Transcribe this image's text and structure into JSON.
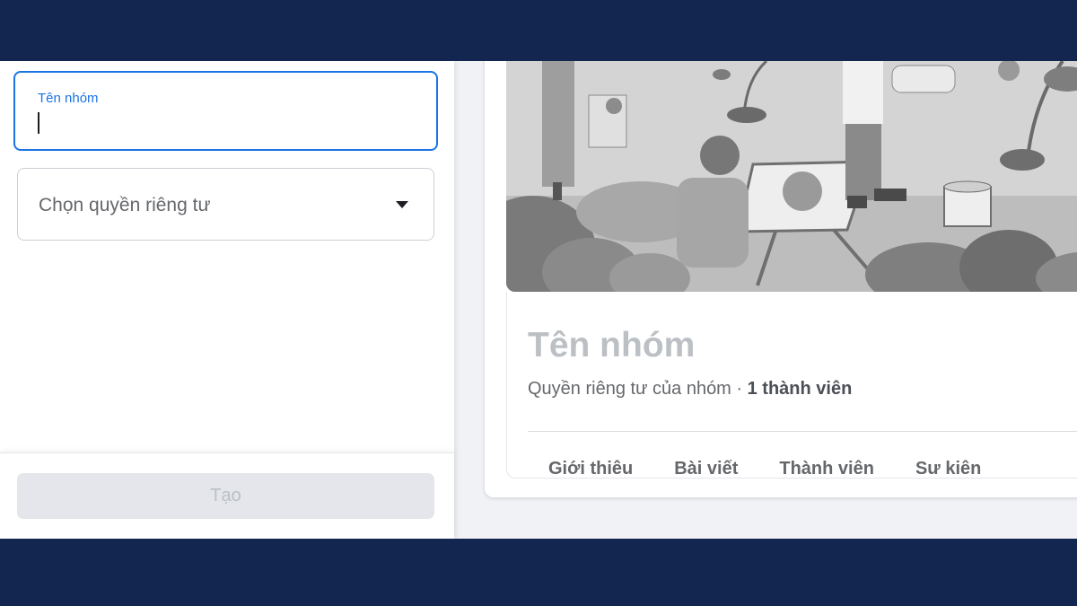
{
  "form": {
    "name_label": "Tên nhóm",
    "name_value": "",
    "privacy_placeholder": "Chọn quyền riêng tư",
    "create_label": "Tạo"
  },
  "preview": {
    "group_name": "Tên nhóm",
    "privacy_text": "Quyền riêng tư của nhóm · ",
    "member_count": "1 thành viên",
    "tabs": [
      "Giới thiêu",
      "Bài viết",
      "Thành viên",
      "Sư kiên"
    ]
  },
  "colors": {
    "brand_band": "#132650",
    "accent": "#1b74e4",
    "disabled_button": "#e4e6eb"
  }
}
